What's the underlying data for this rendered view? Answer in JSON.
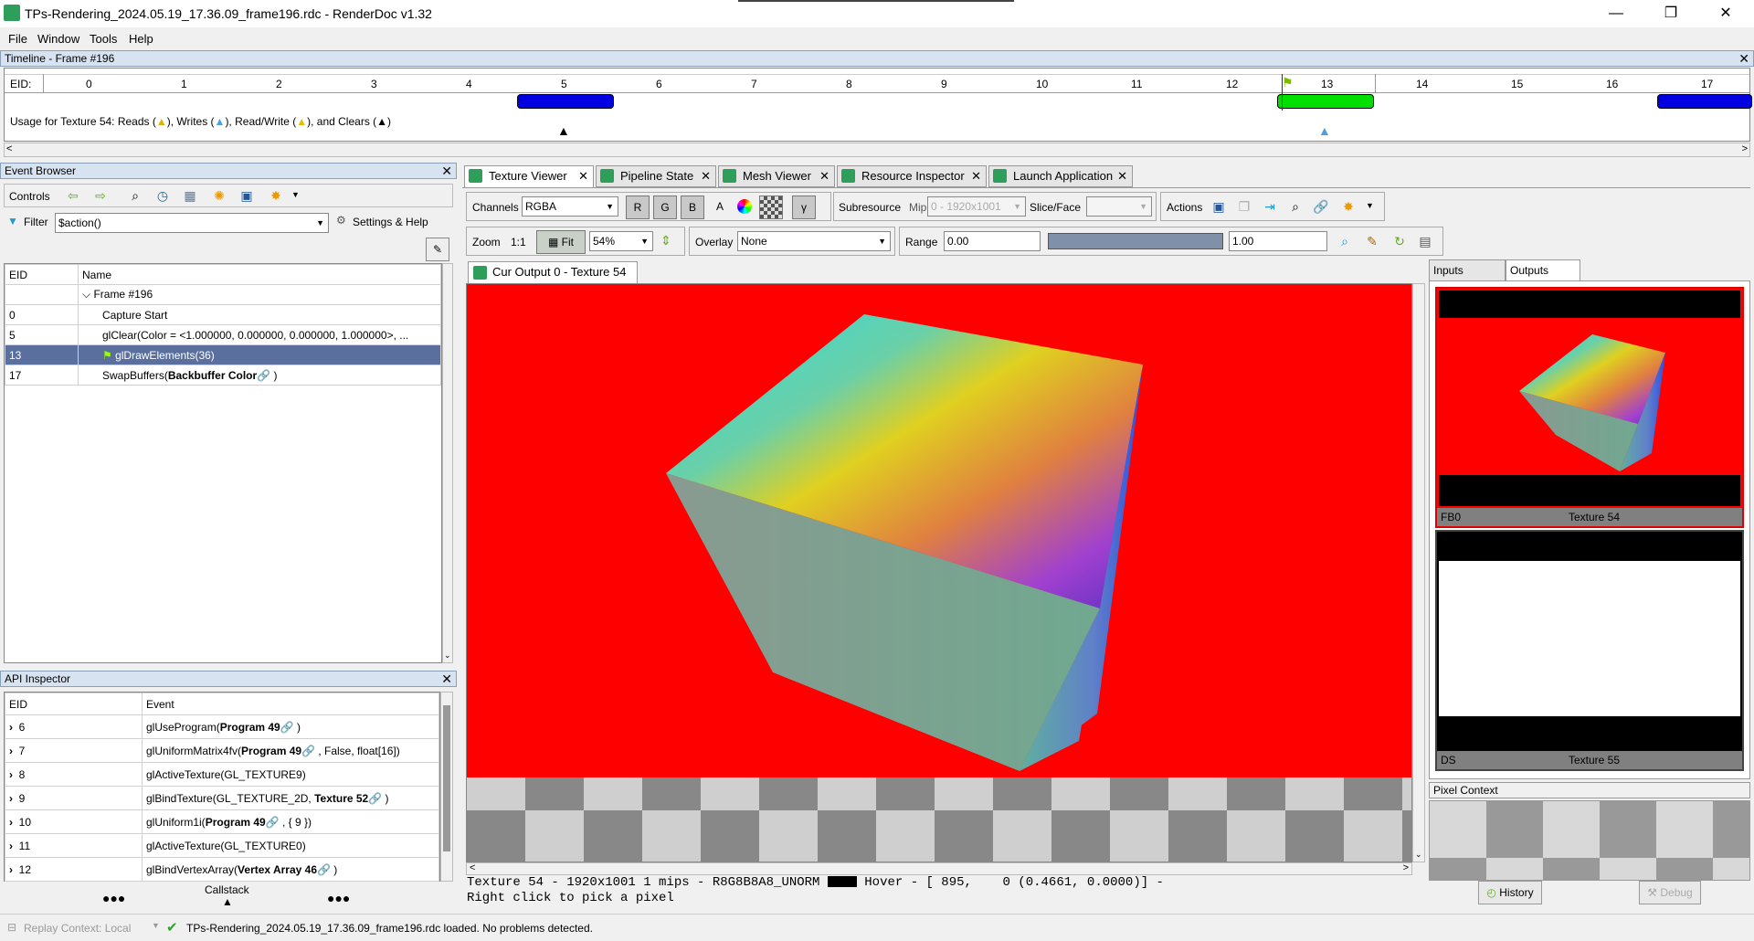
{
  "window": {
    "title": "TPs-Rendering_2024.05.19_17.36.09_frame196.rdc - RenderDoc v1.32",
    "minimize": "—",
    "maximize": "❐",
    "close": "✕"
  },
  "menu": [
    "File",
    "Window",
    "Tools",
    "Help"
  ],
  "timeline": {
    "title": "Timeline - Frame #196",
    "eid_label": "EID:",
    "ticks": [
      "0",
      "1",
      "2",
      "3",
      "4",
      "5",
      "6",
      "7",
      "8",
      "9",
      "10",
      "11",
      "12",
      "13",
      "14",
      "15",
      "16",
      "17"
    ],
    "usage_prefix": "Usage for Texture 54: Reads (",
    "usage_writes": "), Writes (",
    "usage_rw": "), Read/Write (",
    "usage_clears": "), and Clears (",
    "usage_end": ")",
    "colors": {
      "reads": "#0000e0",
      "current": "#00e000"
    }
  },
  "event_browser": {
    "title": "Event Browser",
    "controls_label": "Controls",
    "filter_label": "Filter",
    "filter_value": "$action()",
    "settings_label": "Settings & Help",
    "columns": [
      "EID",
      "Name"
    ],
    "rows": [
      {
        "eid": "",
        "name": "Frame #196"
      },
      {
        "eid": "0",
        "name": "Capture Start"
      },
      {
        "eid": "5",
        "name": "glClear(Color = <1.000000, 0.000000, 0.000000, 1.000000>, ..."
      },
      {
        "eid": "13",
        "name": "glDrawElements(36)"
      },
      {
        "eid": "17",
        "name": "SwapBuffers(",
        "bold": "Backbuffer Color",
        "end": " )"
      }
    ]
  },
  "api_inspector": {
    "title": "API Inspector",
    "columns": [
      "EID",
      "Event"
    ],
    "rows": [
      {
        "eid": "6",
        "pre": "glUseProgram(",
        "bold": "Program 49",
        "post": " )"
      },
      {
        "eid": "7",
        "pre": "glUniformMatrix4fv(",
        "bold": "Program 49",
        "post": " , False, float[16])"
      },
      {
        "eid": "8",
        "pre": "glActiveTexture(GL_TEXTURE9)",
        "bold": "",
        "post": ""
      },
      {
        "eid": "9",
        "pre": "glBindTexture(GL_TEXTURE_2D, ",
        "bold": "Texture 52",
        "post": " )"
      },
      {
        "eid": "10",
        "pre": "glUniform1i(",
        "bold": "Program 49",
        "post": " , { 9 })"
      },
      {
        "eid": "11",
        "pre": "glActiveTexture(GL_TEXTURE0)",
        "bold": "",
        "post": ""
      },
      {
        "eid": "12",
        "pre": "glBindVertexArray(",
        "bold": "Vertex Array 46",
        "post": " )"
      }
    ],
    "callstack_label": "Callstack"
  },
  "tabs": [
    "Texture Viewer",
    "Pipeline State",
    "Mesh Viewer",
    "Resource Inspector",
    "Launch Application"
  ],
  "texture_viewer": {
    "channels_label": "Channels",
    "channels_value": "RGBA",
    "channel_buttons": [
      "R",
      "G",
      "B",
      "A"
    ],
    "gamma_label": "γ",
    "subresource_label": "Subresource",
    "mip_label": "Mip",
    "mip_value": "0 - 1920x1001",
    "slice_label": "Slice/Face",
    "actions_label": "Actions",
    "zoom_label": "Zoom",
    "zoom_1to1": "1:1",
    "fit_label": "Fit",
    "zoom_value": "54%",
    "overlay_label": "Overlay",
    "overlay_value": "None",
    "range_label": "Range",
    "range_min": "0.00",
    "range_max": "1.00",
    "output_tab": "Cur Output 0 - Texture 54",
    "status_line1": "Texture 54 - 1920x1001 1 mips - R8G8B8A8_UNORM",
    "hover_text": "Hover - [ 895,    0 (0.4661, 0.0000)] -",
    "status_line2": "Right click to pick a pixel",
    "clear_color": "#ff0000"
  },
  "thumbnails": {
    "tabs": [
      "Inputs",
      "Outputs"
    ],
    "items": [
      {
        "slot": "FB0",
        "name": "Texture 54"
      },
      {
        "slot": "DS",
        "name": "Texture 55"
      }
    ]
  },
  "pixel_context": {
    "title": "Pixel Context",
    "history": "History",
    "debug": "Debug"
  },
  "statusbar": {
    "replay": "Replay Context: Local",
    "message": "TPs-Rendering_2024.05.19_17.36.09_frame196.rdc loaded. No problems detected."
  }
}
